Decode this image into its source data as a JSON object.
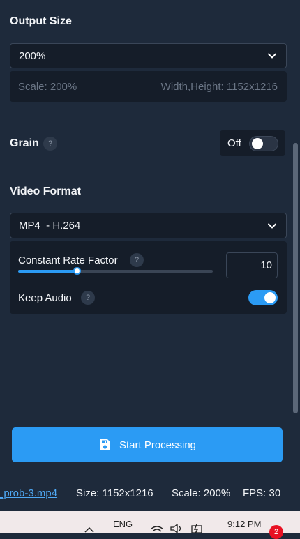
{
  "output_size": {
    "title": "Output Size",
    "selected": "200%",
    "scale_info": "Scale: 200%",
    "dimensions_info": "Width,Height: 1152x1216"
  },
  "grain": {
    "label": "Grain",
    "help": "?",
    "state_label": "Off",
    "enabled": false
  },
  "video_format": {
    "title": "Video Format",
    "selected": "MP4  - H.264",
    "crf_label": "Constant Rate Factor",
    "crf_help": "?",
    "crf_value": "10",
    "crf_slider_fraction": 0.3,
    "keep_audio_label": "Keep Audio",
    "keep_audio_help": "?",
    "keep_audio_enabled": true
  },
  "actions": {
    "start_label": "Start Processing"
  },
  "status_bar": {
    "filename": "_prob-3.mp4",
    "size": "Size: 1152x1216",
    "scale": "Scale: 200%",
    "fps": "FPS: 30"
  },
  "taskbar": {
    "language": "ENG",
    "time": "9:12 PM",
    "notification_count": "2"
  },
  "colors": {
    "background": "#1e2a3b",
    "accent": "#2b9bf4",
    "panel": "#151d29",
    "badge": "#e81123"
  }
}
